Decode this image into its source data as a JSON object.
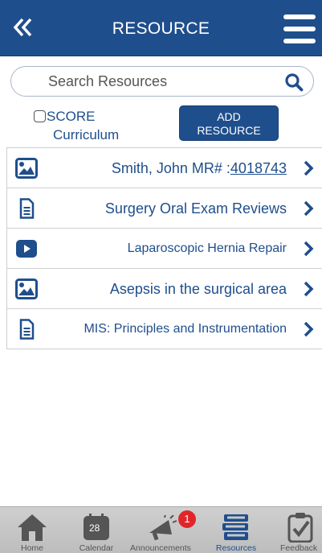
{
  "header": {
    "title": "RESOURCE",
    "back_icon": "double-chevron-left-icon",
    "menu_icon": "hamburger-menu-icon"
  },
  "search": {
    "placeholder": "Search Resources",
    "value": "",
    "icon": "search-icon"
  },
  "filter": {
    "checked": false,
    "label_line1": "SCORE",
    "label_line2": "Curriculum"
  },
  "add_button": {
    "line1": "ADD",
    "line2": "RESOURCE"
  },
  "resources": [
    {
      "icon": "image-icon",
      "label_prefix": "Smith, John MR# :",
      "label_link": "4018743"
    },
    {
      "icon": "document-icon",
      "label": "Surgery Oral Exam Reviews"
    },
    {
      "icon": "video-play-icon",
      "label": "Laparoscopic Hernia Repair"
    },
    {
      "icon": "image-icon",
      "label": "Asepsis in the surgical area"
    },
    {
      "icon": "document-icon",
      "label": "MIS: Principles and Instrumentation"
    }
  ],
  "tabbar": {
    "tabs": [
      {
        "label": "Home",
        "icon": "home-icon"
      },
      {
        "label": "Calendar",
        "icon": "calendar-icon",
        "day": "28"
      },
      {
        "label": "Announcements",
        "icon": "megaphone-icon",
        "badge": "1"
      },
      {
        "label": "Resources",
        "icon": "books-icon",
        "active": true
      },
      {
        "label": "Feedback",
        "icon": "clipboard-check-icon"
      }
    ]
  },
  "colors": {
    "brand": "#1f4e8c",
    "badge": "#e0262a",
    "tabbar": "#c8c8c8"
  }
}
